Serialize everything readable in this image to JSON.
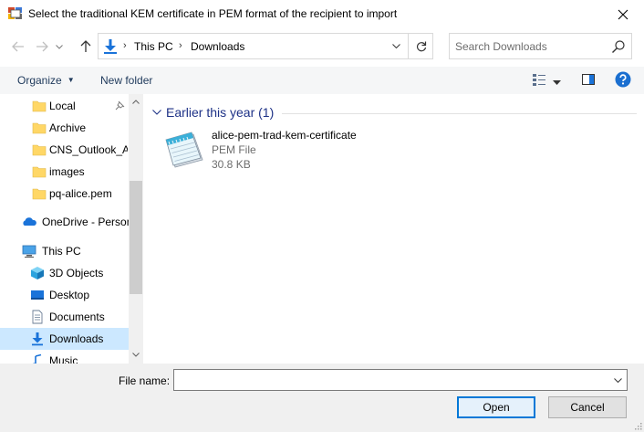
{
  "window": {
    "title": "Select the traditional KEM certificate in PEM format of the recipient to import"
  },
  "address": {
    "path": [
      "This PC",
      "Downloads"
    ]
  },
  "search": {
    "placeholder": "Search Downloads"
  },
  "commandbar": {
    "organize_label": "Organize",
    "new_folder_label": "New folder"
  },
  "sidebar": {
    "items": [
      {
        "label": "Local",
        "icon": "folder-icon",
        "pinned": true
      },
      {
        "label": "Archive",
        "icon": "folder-icon"
      },
      {
        "label": "CNS_Outlook_Add",
        "icon": "folder-icon"
      },
      {
        "label": "images",
        "icon": "folder-icon"
      },
      {
        "label": "pq-alice.pem",
        "icon": "folder-icon"
      },
      {
        "label": "OneDrive - Person",
        "icon": "onedrive-icon"
      },
      {
        "label": "This PC",
        "icon": "pc-icon"
      },
      {
        "label": "3D Objects",
        "icon": "cube-icon"
      },
      {
        "label": "Desktop",
        "icon": "desktop-icon"
      },
      {
        "label": "Documents",
        "icon": "documents-icon"
      },
      {
        "label": "Downloads",
        "icon": "download-icon",
        "selected": true
      },
      {
        "label": "Music",
        "icon": "music-icon"
      }
    ]
  },
  "content": {
    "group_header": "Earlier this year (1)",
    "files": [
      {
        "name": "alice-pem-trad-kem-certificate",
        "type": "PEM File",
        "size": "30.8 KB",
        "icon": "notepad-file-icon"
      }
    ]
  },
  "footer": {
    "file_name_label": "File name:",
    "file_name_value": "",
    "open_label": "Open",
    "cancel_label": "Cancel"
  },
  "colors": {
    "accent": "#0078d7",
    "selected_bg": "#cce8ff",
    "group_header": "#1e3287",
    "folder": "#ffd766"
  }
}
